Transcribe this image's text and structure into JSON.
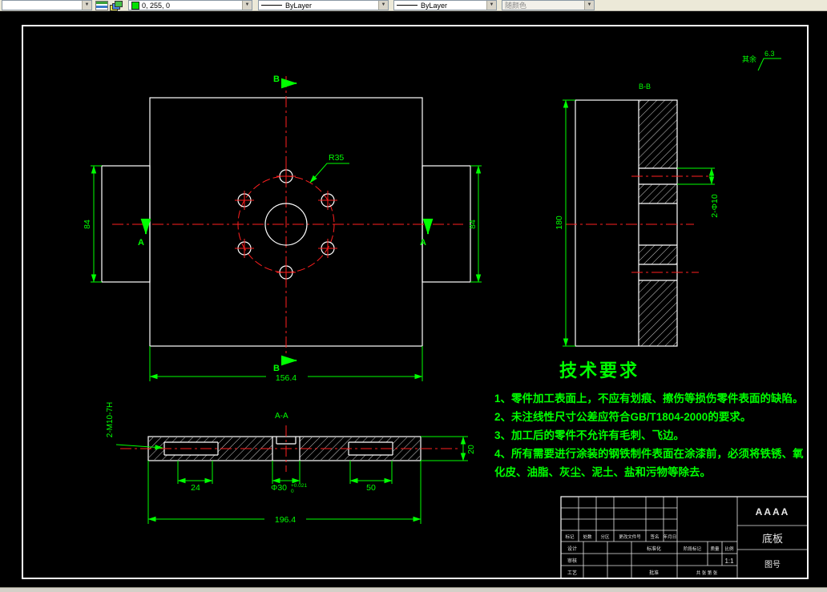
{
  "toolbar": {
    "layer_value": "",
    "color_value": "0, 255, 0",
    "linetype_value": "ByLayer",
    "lineweight_value": "ByLayer",
    "plotstyle_value": "随颜色"
  },
  "annotations": {
    "surface_prefix": "其余",
    "surface_finish": "6.3",
    "r35": "R35",
    "sec_a": "A",
    "sec_b": "B",
    "bb": "B-B",
    "aa": "A-A"
  },
  "dims": {
    "left_84": "84",
    "right_84": "84",
    "front_width": "156.4",
    "side_height": "180",
    "side_holes": "2-Φ10",
    "slot_left": "24",
    "slot_right": "50",
    "bore_main": "Φ30",
    "bore_tol_up": "+0.021",
    "bore_tol_dn": "0",
    "total_length": "196.4",
    "thickness": "20",
    "tap_note": "2-M10-7H"
  },
  "tech": {
    "title": "技术要求",
    "items": [
      "1、零件加工表面上，不应有划痕、擦伤等损伤零件表面的缺陷。",
      "2、未注线性尺寸公差应符合GB/T1804-2000的要求。",
      "3、加工后的零件不允许有毛刺、飞边。",
      "4、所有需要进行涂装的钢铁制件表面在涂漆前，必须将铁锈、氧化皮、油脂、灰尘、泥土、盐和污物等除去。"
    ]
  },
  "title_block": {
    "company": "AAAA",
    "part_name": "底板",
    "drawing_no": "图号",
    "scale_value": "1:1",
    "rev_headers": [
      "标记",
      "处数",
      "分区",
      "更改文件号",
      "签名",
      "年月日"
    ],
    "roles": [
      "设计",
      "审核",
      "工艺"
    ],
    "roles2": [
      "标准化",
      "批准"
    ],
    "stage": "阶段标记",
    "mass": "质量",
    "scale_label": "比例",
    "sheets": "共 张 第 张"
  }
}
